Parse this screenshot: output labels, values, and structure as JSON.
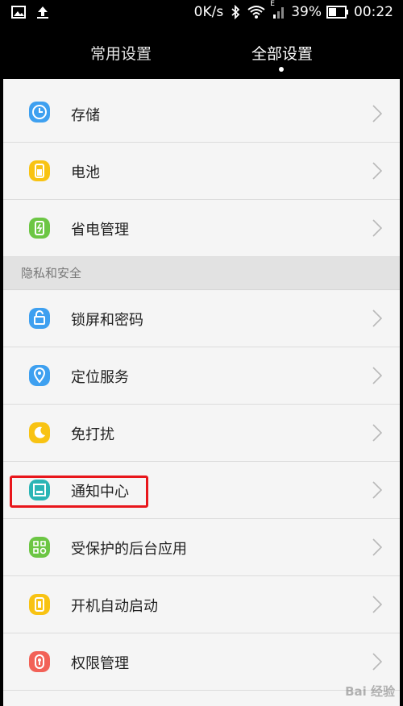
{
  "status_bar": {
    "speed": "0K/s",
    "signal_label": "E",
    "battery": "39%",
    "time": "00:22"
  },
  "tabs": {
    "common": "常用设置",
    "all": "全部设置"
  },
  "items_top": [
    {
      "label": "存储",
      "icon": "storage-icon",
      "color": "#3ea0f0"
    },
    {
      "label": "电池",
      "icon": "battery-icon",
      "color": "#f8c313"
    },
    {
      "label": "省电管理",
      "icon": "power-saving-icon",
      "color": "#6cc644"
    }
  ],
  "section": "隐私和安全",
  "items_privacy": [
    {
      "label": "锁屏和密码",
      "icon": "lock-icon",
      "color": "#3ea0f0"
    },
    {
      "label": "定位服务",
      "icon": "location-icon",
      "color": "#3ea0f0"
    },
    {
      "label": "免打扰",
      "icon": "moon-icon",
      "color": "#f8c313"
    },
    {
      "label": "通知中心",
      "icon": "notification-icon",
      "color": "#2bb5b5"
    },
    {
      "label": "受保护的后台应用",
      "icon": "protected-apps-icon",
      "color": "#6cc644"
    },
    {
      "label": "开机自动启动",
      "icon": "autostart-icon",
      "color": "#f8c313"
    },
    {
      "label": "权限管理",
      "icon": "permission-icon",
      "color": "#f26157"
    }
  ],
  "watermark": "Bai 经验"
}
